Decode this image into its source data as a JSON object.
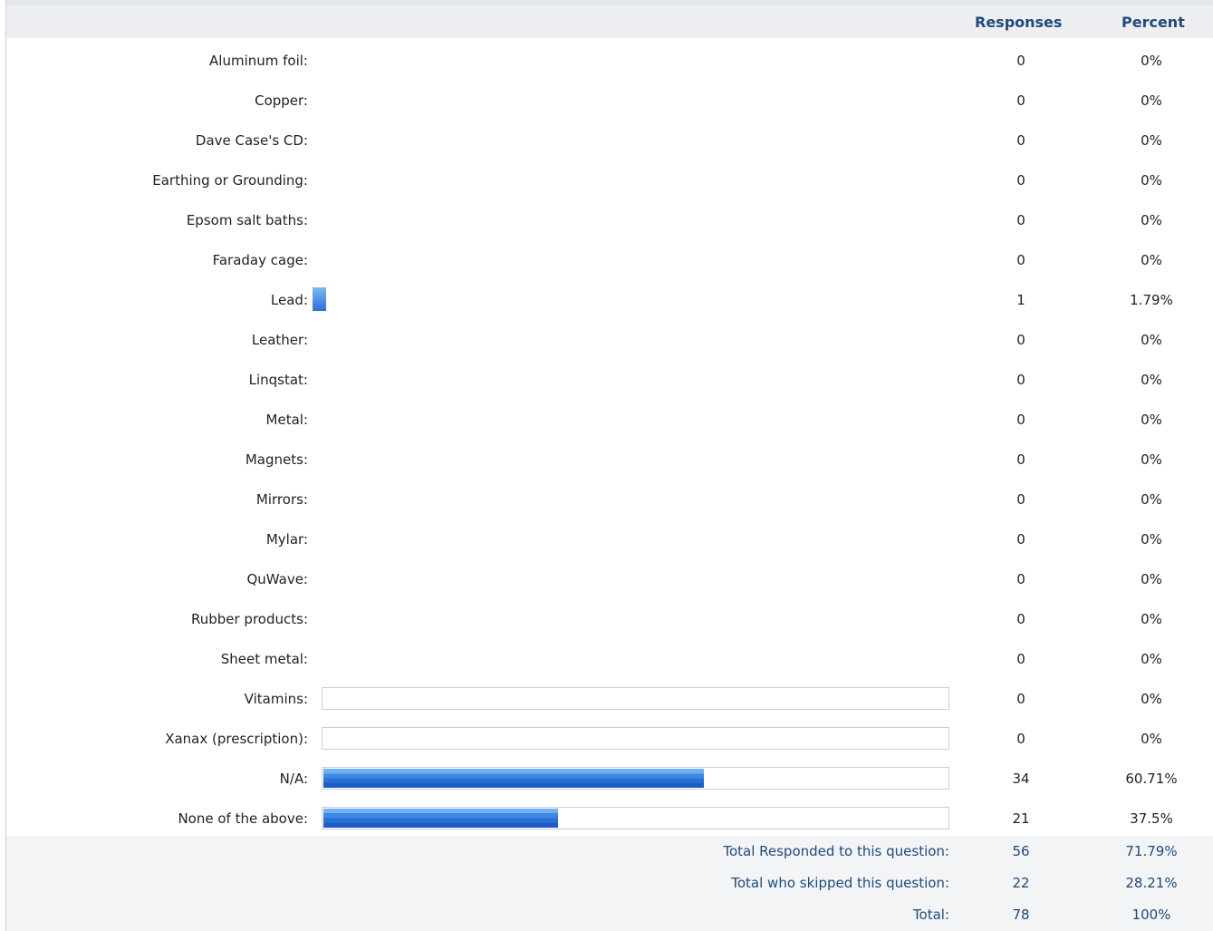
{
  "header": {
    "responses_label": "Responses",
    "percent_label": "Percent"
  },
  "rows": [
    {
      "label": "Aluminum foil:",
      "count": "0",
      "percent": "0%",
      "fraction": 0,
      "bar": "none"
    },
    {
      "label": "Copper:",
      "count": "0",
      "percent": "0%",
      "fraction": 0,
      "bar": "none"
    },
    {
      "label": "Dave Case's CD:",
      "count": "0",
      "percent": "0%",
      "fraction": 0,
      "bar": "none"
    },
    {
      "label": "Earthing or Grounding:",
      "count": "0",
      "percent": "0%",
      "fraction": 0,
      "bar": "none"
    },
    {
      "label": "Epsom salt baths:",
      "count": "0",
      "percent": "0%",
      "fraction": 0,
      "bar": "none"
    },
    {
      "label": "Faraday cage:",
      "count": "0",
      "percent": "0%",
      "fraction": 0,
      "bar": "none"
    },
    {
      "label": "Lead:",
      "count": "1",
      "percent": "1.79%",
      "fraction": 0.0179,
      "bar": "mini"
    },
    {
      "label": "Leather:",
      "count": "0",
      "percent": "0%",
      "fraction": 0,
      "bar": "none"
    },
    {
      "label": "Linqstat:",
      "count": "0",
      "percent": "0%",
      "fraction": 0,
      "bar": "none"
    },
    {
      "label": "Metal:",
      "count": "0",
      "percent": "0%",
      "fraction": 0,
      "bar": "none"
    },
    {
      "label": "Magnets:",
      "count": "0",
      "percent": "0%",
      "fraction": 0,
      "bar": "none"
    },
    {
      "label": "Mirrors:",
      "count": "0",
      "percent": "0%",
      "fraction": 0,
      "bar": "none"
    },
    {
      "label": "Mylar:",
      "count": "0",
      "percent": "0%",
      "fraction": 0,
      "bar": "none"
    },
    {
      "label": "QuWave:",
      "count": "0",
      "percent": "0%",
      "fraction": 0,
      "bar": "none"
    },
    {
      "label": "Rubber products:",
      "count": "0",
      "percent": "0%",
      "fraction": 0,
      "bar": "none"
    },
    {
      "label": "Sheet metal:",
      "count": "0",
      "percent": "0%",
      "fraction": 0,
      "bar": "none"
    },
    {
      "label": "Vitamins:",
      "count": "0",
      "percent": "0%",
      "fraction": 0,
      "bar": "track"
    },
    {
      "label": "Xanax (prescription):",
      "count": "0",
      "percent": "0%",
      "fraction": 0,
      "bar": "track"
    },
    {
      "label": "N/A:",
      "count": "34",
      "percent": "60.71%",
      "fraction": 0.6071,
      "bar": "track"
    },
    {
      "label": "None of the above:",
      "count": "21",
      "percent": "37.5%",
      "fraction": 0.375,
      "bar": "track"
    }
  ],
  "footer": [
    {
      "label": "Total Responded to  this question:",
      "count": "56",
      "percent": "71.79%"
    },
    {
      "label": "Total who skipped  this question:",
      "count": "22",
      "percent": "28.21%"
    },
    {
      "label": "Total:",
      "count": "78",
      "percent": "100%"
    }
  ],
  "colors": {
    "header_text": "#1f4a7a",
    "bar": "#2a6fd6",
    "footer_bg": "#f3f4f6"
  }
}
